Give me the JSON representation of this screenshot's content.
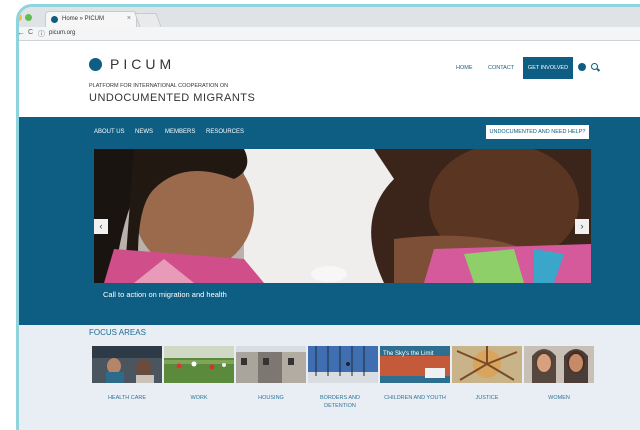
{
  "browser": {
    "tab_title": "Home » PICUM",
    "tab_close": "×",
    "url": "picum.org",
    "back": "←",
    "reload": "C"
  },
  "header": {
    "logo": "PICUM",
    "tagline_small": "PLATFORM FOR INTERNATIONAL COOPERATION ON",
    "tagline_large": "UNDOCUMENTED MIGRANTS",
    "links": [
      "HOME",
      "CONTACT"
    ],
    "cta": "GET INVOLVED"
  },
  "menu": {
    "items": [
      "ABOUT US",
      "NEWS",
      "MEMBERS",
      "RESOURCES"
    ],
    "help": "UNDOCUMENTED AND NEED HELP?"
  },
  "slider": {
    "prev": "‹",
    "next": "›",
    "caption": "Call to action on migration and health"
  },
  "focus": {
    "title": "FOCUS AREAS",
    "items": [
      {
        "label": "HEALTH CARE"
      },
      {
        "label": "WORK"
      },
      {
        "label": "HOUSING"
      },
      {
        "label": "BORDERS AND DETENTION"
      },
      {
        "label": "CHILDREN AND YOUTH"
      },
      {
        "label": "JUSTICE"
      },
      {
        "label": "WOMEN"
      }
    ],
    "sign_text": "The Sky's the Limit"
  },
  "colors": {
    "brand": "#0e5d82",
    "frame": "#8fd3dc"
  }
}
